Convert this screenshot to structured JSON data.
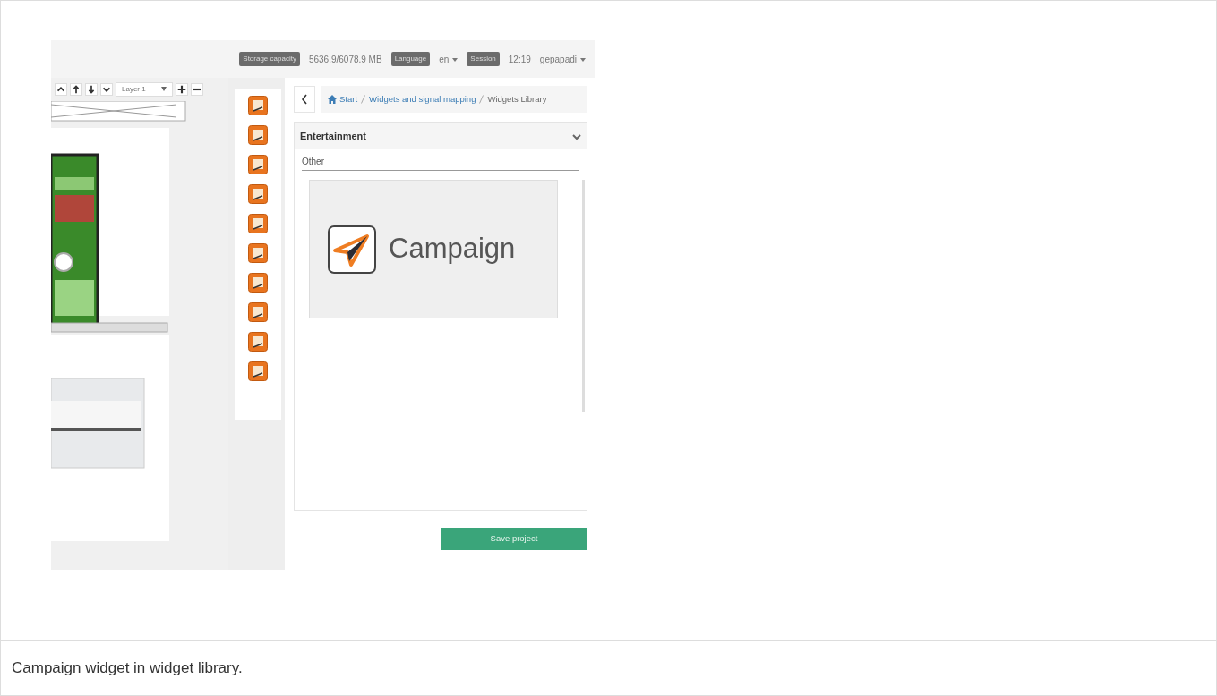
{
  "top_bar": {
    "storage_label": "Storage capacity",
    "storage_value": "5636.9/6078.9 MB",
    "language_label": "Language",
    "language": "en",
    "session_label": "Session",
    "time": "12:19",
    "user": "gepapadi"
  },
  "editor_toolbar": {
    "layer_select": "Layer 1"
  },
  "breadcrumb": [
    {
      "label": "Start",
      "kind": "home"
    },
    {
      "label": "Widgets and signal mapping",
      "kind": "link"
    },
    {
      "label": "Widgets Library",
      "kind": "current"
    }
  ],
  "category": {
    "title": "Entertainment",
    "expanded": true
  },
  "section": "Other",
  "widgets": [
    {
      "label": "Campaign"
    }
  ],
  "save_button": "Save project",
  "caption": "Campaign widget in widget library."
}
